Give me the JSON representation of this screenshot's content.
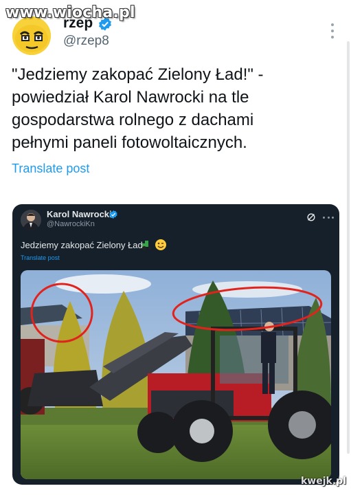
{
  "watermark": "www.wiocha.pl",
  "author": {
    "name": "rzep",
    "handle": "@rzep8",
    "avatar_icon": "cartoon-face-avatar",
    "verified": true
  },
  "post": {
    "text": "\"Jedziemy zakopać Zielony Ład!\" -\npowiedział Karol Nawrocki na tle\ngospodarstwa rolnego z dachami\npełnymi paneli fotowoltaicznych.",
    "translate_label": "Translate post"
  },
  "quoted_post": {
    "author_name": "Karol Nawrocki",
    "author_handle": "@NawrockiKn",
    "verified": true,
    "text": "Jedziemy zakopać Zielony Ład",
    "emoji": [
      "tractor-emoji",
      "winking-face-emoji"
    ],
    "translate_label": "Translate post",
    "image_description_icons": [
      "tractor-photo",
      "red-circle-annotation",
      "red-circle-annotation"
    ]
  },
  "site_watermark": "kwejk.pl",
  "colors": {
    "link": "#1d9bf0",
    "card_background": "#15202b",
    "verified": "#1d9bf0",
    "annotation": "#e0231c"
  }
}
